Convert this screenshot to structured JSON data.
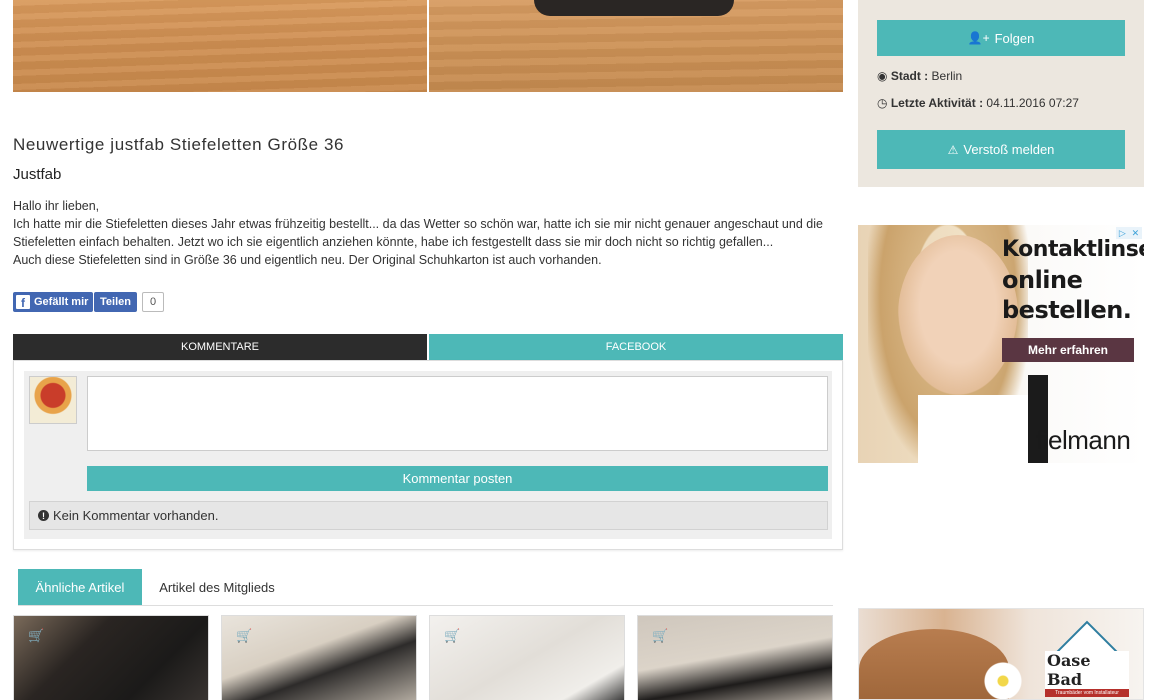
{
  "product": {
    "title": "Neuwertige justfab Stiefeletten Größe 36",
    "brand": "Justfab",
    "description": [
      "Hallo ihr lieben,",
      "Ich hatte mir die Stiefeletten dieses Jahr etwas frühzeitig bestellt... da das Wetter so schön war, hatte ich sie mir nicht genauer angeschaut und die Stiefeletten einfach behalten. Jetzt wo ich sie eigentlich anziehen könnte, habe ich festgestellt dass sie mir doch nicht so richtig gefallen...",
      "Auch diese Stiefeletten sind in Größe 36 und eigentlich neu. Der Original Schuhkarton ist auch vorhanden."
    ]
  },
  "facebook_buttons": {
    "like_label": "Gefällt mir",
    "share_label": "Teilen",
    "share_count": "0"
  },
  "comment_tabs": {
    "comments_label": "KOMMENTARE",
    "facebook_label": "FACEBOOK"
  },
  "comment_form": {
    "textarea_value": "",
    "post_button_label": "Kommentar posten",
    "empty_message": "Kein Kommentar vorhanden."
  },
  "article_tabs": {
    "similar_label": "Ähnliche Artikel",
    "member_label": "Artikel des Mitglieds"
  },
  "seller": {
    "follow_label": "Folgen",
    "city_label": "Stadt :",
    "city_value": "Berlin",
    "last_activity_label": "Letzte Aktivität :",
    "last_activity_value": "04.11.2016 07:27",
    "report_label": "Verstoß melden"
  },
  "ad_contact_lenses": {
    "headline_line1": "Kontaktlinsen",
    "headline_line2": "online",
    "headline_line3": "bestellen.",
    "cta_label": "Mehr erfahren",
    "brand_logo": "fielmann"
  },
  "ad_bath": {
    "logo_name": "Oase Bad",
    "logo_tagline": "Traumbäder vom Installateur"
  },
  "colors": {
    "accent_teal": "#4db8b7",
    "dark_tab": "#2c2c2c",
    "sidebar_bg": "#ece7df",
    "facebook_blue": "#4267b2"
  },
  "icons": {
    "follow": "user-plus-icon",
    "city": "map-marker-icon",
    "activity": "clock-icon",
    "report": "warning-icon",
    "cart": "shopping-cart-icon",
    "info": "info-circle-icon"
  }
}
